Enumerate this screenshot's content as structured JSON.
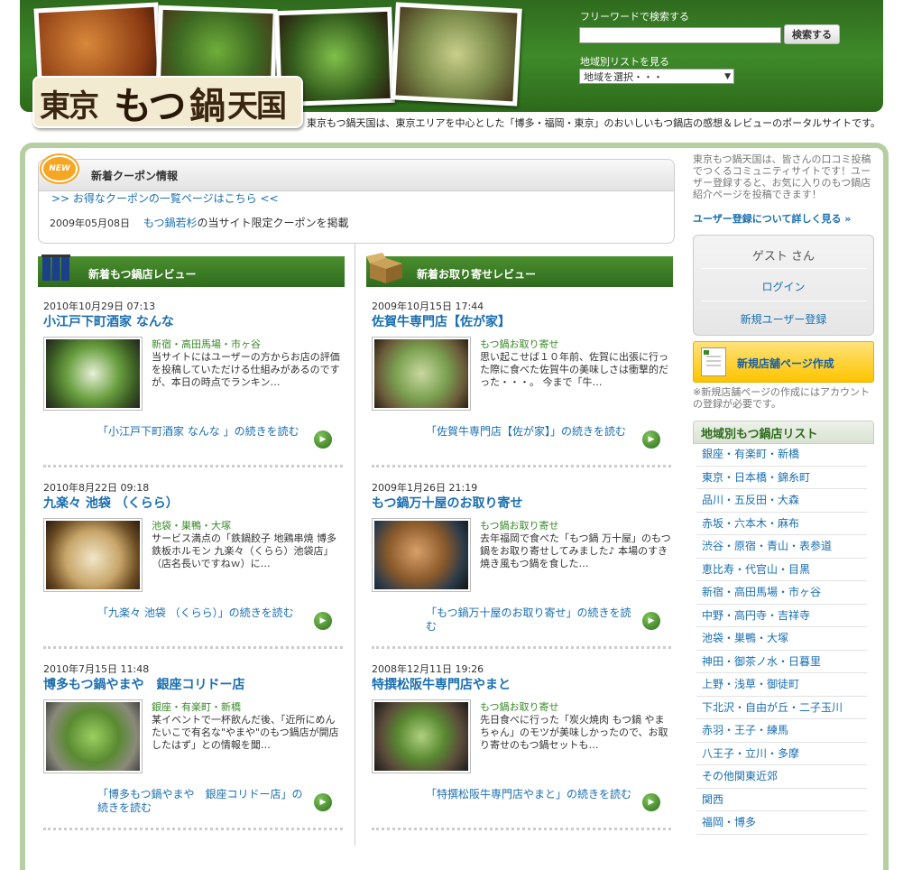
{
  "header": {
    "logo_text": [
      "東京",
      "もつ",
      "鍋",
      "天国"
    ],
    "tagline": "東京もつ鍋天国は、東京エリアを中心とした「博多・福岡・東京」のおいしいもつ鍋店の感想＆レビューのポータルサイトです。",
    "search_label": "フリーワードで検索する",
    "search_value": "",
    "search_button": "検索する",
    "area_label": "地域別リストを見る",
    "area_select": "地域を選択・・・"
  },
  "coupon": {
    "badge": "NEW",
    "title": "新着クーポン情報",
    "link": ">> お得なクーポンの一覧ページはこちら <<",
    "date": "2009年05月08日",
    "store": "もつ鍋若杉",
    "text": "の当サイト限定クーポンを掲載"
  },
  "reviews": {
    "title": "新着もつ鍋店レビュー",
    "items": [
      {
        "date": "2010年10月29日 07:13",
        "title": "小江戸下町酒家 なんな",
        "category": "新宿・高田馬場・市ヶ谷",
        "desc": "当サイトにはユーザーの方からお店の評価を投稿していただける仕組みがあるのですが、本日の時点でランキン…",
        "more": "「小江戸下町酒家 なんな 」の続きを読む"
      },
      {
        "date": "2010年8月22日 09:18",
        "title": "九楽々 池袋 （くらら）",
        "category": "池袋・巣鴨・大塚",
        "desc": "サービス満点の「鉄鍋餃子 地鶏串焼 博多鉄板ホルモン 九楽々（くらら）池袋店」（店名長いですねｗ）に…",
        "more": "「九楽々 池袋 （くらら）」の続きを読む"
      },
      {
        "date": "2010年7月15日 11:48",
        "title": "博多もつ鍋やまや　銀座コリドー店",
        "category": "銀座・有楽町・新橋",
        "desc": "某イベントで一杯飲んだ後、「近所にめんたいこで有名な\"やまや\"のもつ鍋店が開店したはず」との情報を聞…",
        "more": "「博多もつ鍋やまや　銀座コリドー店」の続きを読む"
      }
    ]
  },
  "orders": {
    "title": "新着お取り寄せレビュー",
    "items": [
      {
        "date": "2009年10月15日 17:44",
        "title": "佐賀牛専門店【佐が家】",
        "category": "もつ鍋お取り寄せ",
        "desc": "思い起こせば１０年前、佐賀に出張に行った際に食べた佐賀牛の美味しさは衝撃的だった・・・。 今まで「牛…",
        "more": "「佐賀牛専門店【佐が家】」の続きを読む"
      },
      {
        "date": "2009年1月26日 21:19",
        "title": "もつ鍋万十屋のお取り寄せ",
        "category": "もつ鍋お取り寄せ",
        "desc": "去年福岡で食べた「もつ鍋 万十屋」のもつ鍋をお取り寄せしてみました♪ 本場のすき焼き風もつ鍋を食した…",
        "more": "「もつ鍋万十屋のお取り寄せ」の続きを読む"
      },
      {
        "date": "2008年12月11日 19:26",
        "title": "特撰松阪牛専門店やまと",
        "category": "もつ鍋お取り寄せ",
        "desc": "先日食べに行った「炭火焼肉 もつ鍋 やまちゃん」のモツが美味しかったので、お取り寄せのもつ鍋セットも…",
        "more": "「特撰松阪牛専門店やまと」の続きを読む"
      }
    ]
  },
  "sidebar": {
    "intro": "東京もつ鍋天国は、皆さんの口コミ投稿でつくるコミュニティサイトです！ユーザー登録すると、お気に入りのもつ鍋店紹介ページを投稿できます！",
    "register_info": "ユーザー登録について詳しく見る »",
    "guest": "ゲスト さん",
    "login": "ログイン",
    "signup": "新規ユーザー登録",
    "new_store": "新規店舗ページ作成",
    "note": "※新規店舗ページの作成にはアカウントの登録が必要です。",
    "area_title": "地域別もつ鍋店リスト",
    "areas": [
      "銀座・有楽町・新橋",
      "東京・日本橋・錦糸町",
      "品川・五反田・大森",
      "赤坂・六本木・麻布",
      "渋谷・原宿・青山・表参道",
      "恵比寿・代官山・目黒",
      "新宿・高田馬場・市ヶ谷",
      "中野・高円寺・吉祥寺",
      "池袋・巣鴨・大塚",
      "神田・御茶ノ水・日暮里",
      "上野・浅草・御徒町",
      "下北沢・自由が丘・二子玉川",
      "赤羽・王子・練馬",
      "八王子・立川・多摩",
      "その他関東近郊",
      "関西",
      "福岡・博多"
    ]
  }
}
